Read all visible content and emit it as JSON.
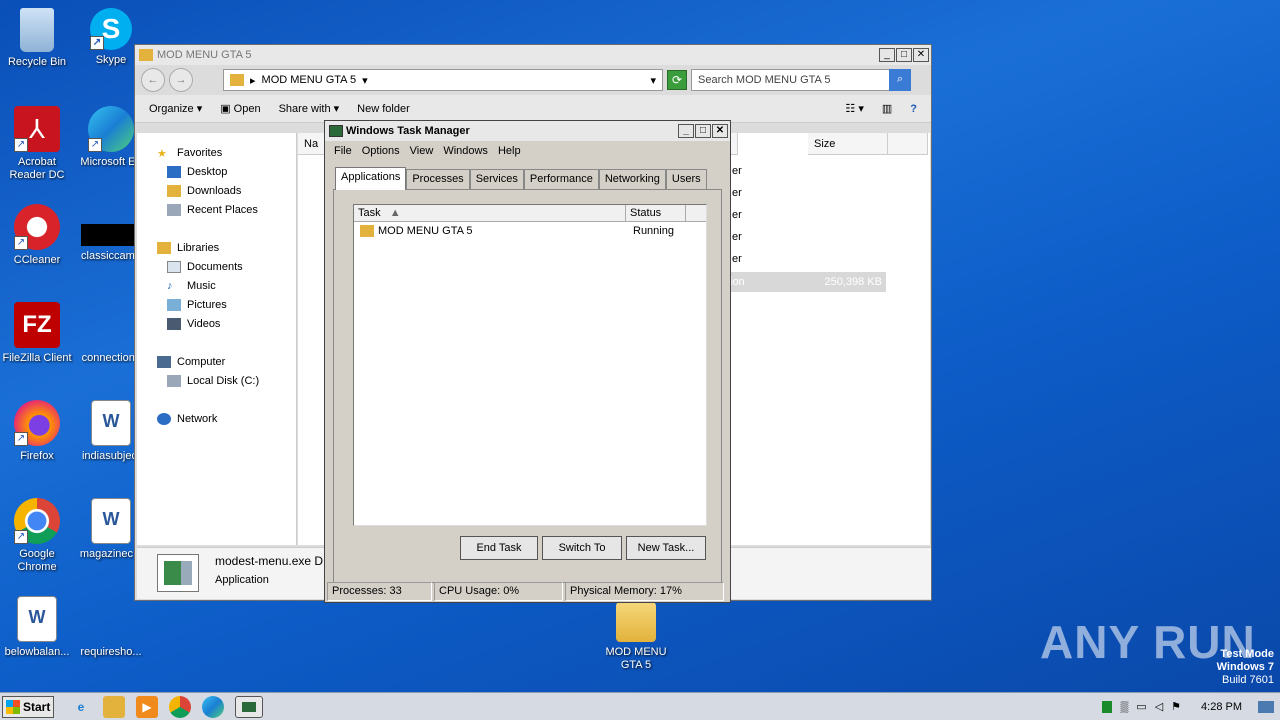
{
  "desktop": {
    "icons": [
      {
        "label": "Recycle Bin"
      },
      {
        "label": "Skype"
      },
      {
        "label": "Acrobat Reader DC"
      },
      {
        "label": "Microsoft Ed"
      },
      {
        "label": "CCleaner"
      },
      {
        "label": "classiccame"
      },
      {
        "label": "FileZilla Client"
      },
      {
        "label": "connectionc"
      },
      {
        "label": "Firefox"
      },
      {
        "label": "indiasubject"
      },
      {
        "label": "Google Chrome"
      },
      {
        "label": "magazinec..."
      },
      {
        "label": "belowbalan..."
      },
      {
        "label": "requiresho..."
      },
      {
        "label": "MOD MENU GTA 5"
      }
    ]
  },
  "explorer": {
    "title": "MOD MENU GTA 5",
    "address": "MOD MENU GTA 5",
    "search_placeholder": "Search MOD MENU GTA 5",
    "toolbar": {
      "organize": "Organize",
      "open": "Open",
      "share_with": "Share with",
      "new_folder": "New folder"
    },
    "nav": {
      "favorites": "Favorites",
      "desktop": "Desktop",
      "downloads": "Downloads",
      "recent": "Recent Places",
      "libraries": "Libraries",
      "documents": "Documents",
      "music": "Music",
      "pictures": "Pictures",
      "videos": "Videos",
      "computer": "Computer",
      "local_disk": "Local Disk (C:)",
      "network": "Network"
    },
    "columns": {
      "name": "Na",
      "size": "Size"
    },
    "rows": [
      {
        "type_suffix": "er",
        "size": ""
      },
      {
        "type_suffix": "er",
        "size": ""
      },
      {
        "type_suffix": "er",
        "size": ""
      },
      {
        "type_suffix": "er",
        "size": ""
      },
      {
        "type_suffix": "er",
        "size": ""
      },
      {
        "type_suffix": "ion",
        "size": "250,398 KB"
      }
    ],
    "details": {
      "filename": "modest-menu.exe",
      "filename_suffix": "D",
      "type": "Application"
    }
  },
  "taskmgr": {
    "title": "Windows Task Manager",
    "menu": {
      "file": "File",
      "options": "Options",
      "view": "View",
      "windows": "Windows",
      "help": "Help"
    },
    "tabs": {
      "applications": "Applications",
      "processes": "Processes",
      "services": "Services",
      "performance": "Performance",
      "networking": "Networking",
      "users": "Users"
    },
    "columns": {
      "task": "Task",
      "status": "Status"
    },
    "tasks": [
      {
        "name": "MOD MENU GTA 5",
        "status": "Running"
      }
    ],
    "buttons": {
      "end_task": "End Task",
      "switch_to": "Switch To",
      "new_task": "New Task..."
    },
    "status": {
      "processes": "Processes: 33",
      "cpu": "CPU Usage: 0%",
      "memory": "Physical Memory: 17%"
    }
  },
  "taskbar": {
    "start": "Start",
    "clock": "4:28 PM"
  },
  "watermark": {
    "line1": "Test Mode",
    "line2": "Windows 7",
    "line3": "Build 7601",
    "brand": "ANY RUN"
  }
}
